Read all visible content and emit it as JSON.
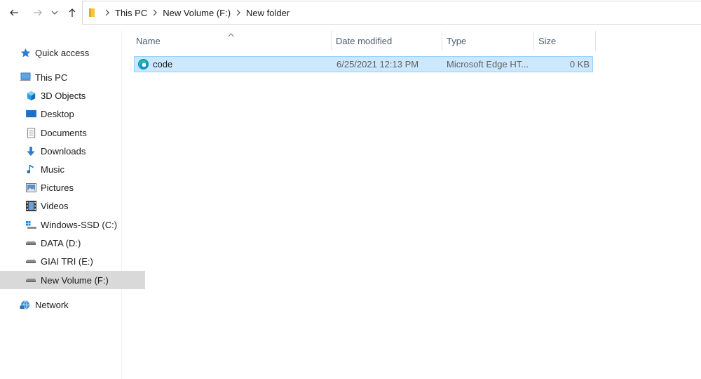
{
  "nav": {
    "back_icon": "back-arrow-icon",
    "forward_icon": "forward-arrow-icon",
    "recent_icon": "chevron-down-icon",
    "up_icon": "up-arrow-icon"
  },
  "breadcrumb": {
    "folder_icon": "folder-icon",
    "items": [
      "This PC",
      "New Volume (F:)",
      "New folder"
    ]
  },
  "sidebar": {
    "items": [
      {
        "label": "Quick access",
        "icon": "star-icon"
      },
      {
        "label": "This PC",
        "icon": "computer-icon"
      },
      {
        "label": "3D Objects",
        "icon": "cube-icon"
      },
      {
        "label": "Desktop",
        "icon": "desktop-icon"
      },
      {
        "label": "Documents",
        "icon": "document-icon"
      },
      {
        "label": "Downloads",
        "icon": "download-icon"
      },
      {
        "label": "Music",
        "icon": "music-icon"
      },
      {
        "label": "Pictures",
        "icon": "picture-icon"
      },
      {
        "label": "Videos",
        "icon": "video-icon"
      },
      {
        "label": "Windows-SSD (C:)",
        "icon": "system-drive-icon"
      },
      {
        "label": "DATA (D:)",
        "icon": "drive-icon"
      },
      {
        "label": "GIAI TRI (E:)",
        "icon": "drive-icon"
      },
      {
        "label": "New Volume (F:)",
        "icon": "drive-icon",
        "selected": true
      },
      {
        "label": "Network",
        "icon": "network-icon"
      }
    ]
  },
  "columns": {
    "name": "Name",
    "date": "Date modified",
    "type": "Type",
    "size": "Size",
    "sort_indicator": "^"
  },
  "files": [
    {
      "name": "code",
      "date": "6/25/2021 12:13 PM",
      "type": "Microsoft Edge HT...",
      "size": "0 KB",
      "icon": "edge-icon",
      "selected": true
    }
  ],
  "colors": {
    "selection_bg": "#cce8ff",
    "selection_border": "#99d1ff",
    "sidebar_selected": "#d9d9d9",
    "header_text": "#4a5c6e"
  }
}
